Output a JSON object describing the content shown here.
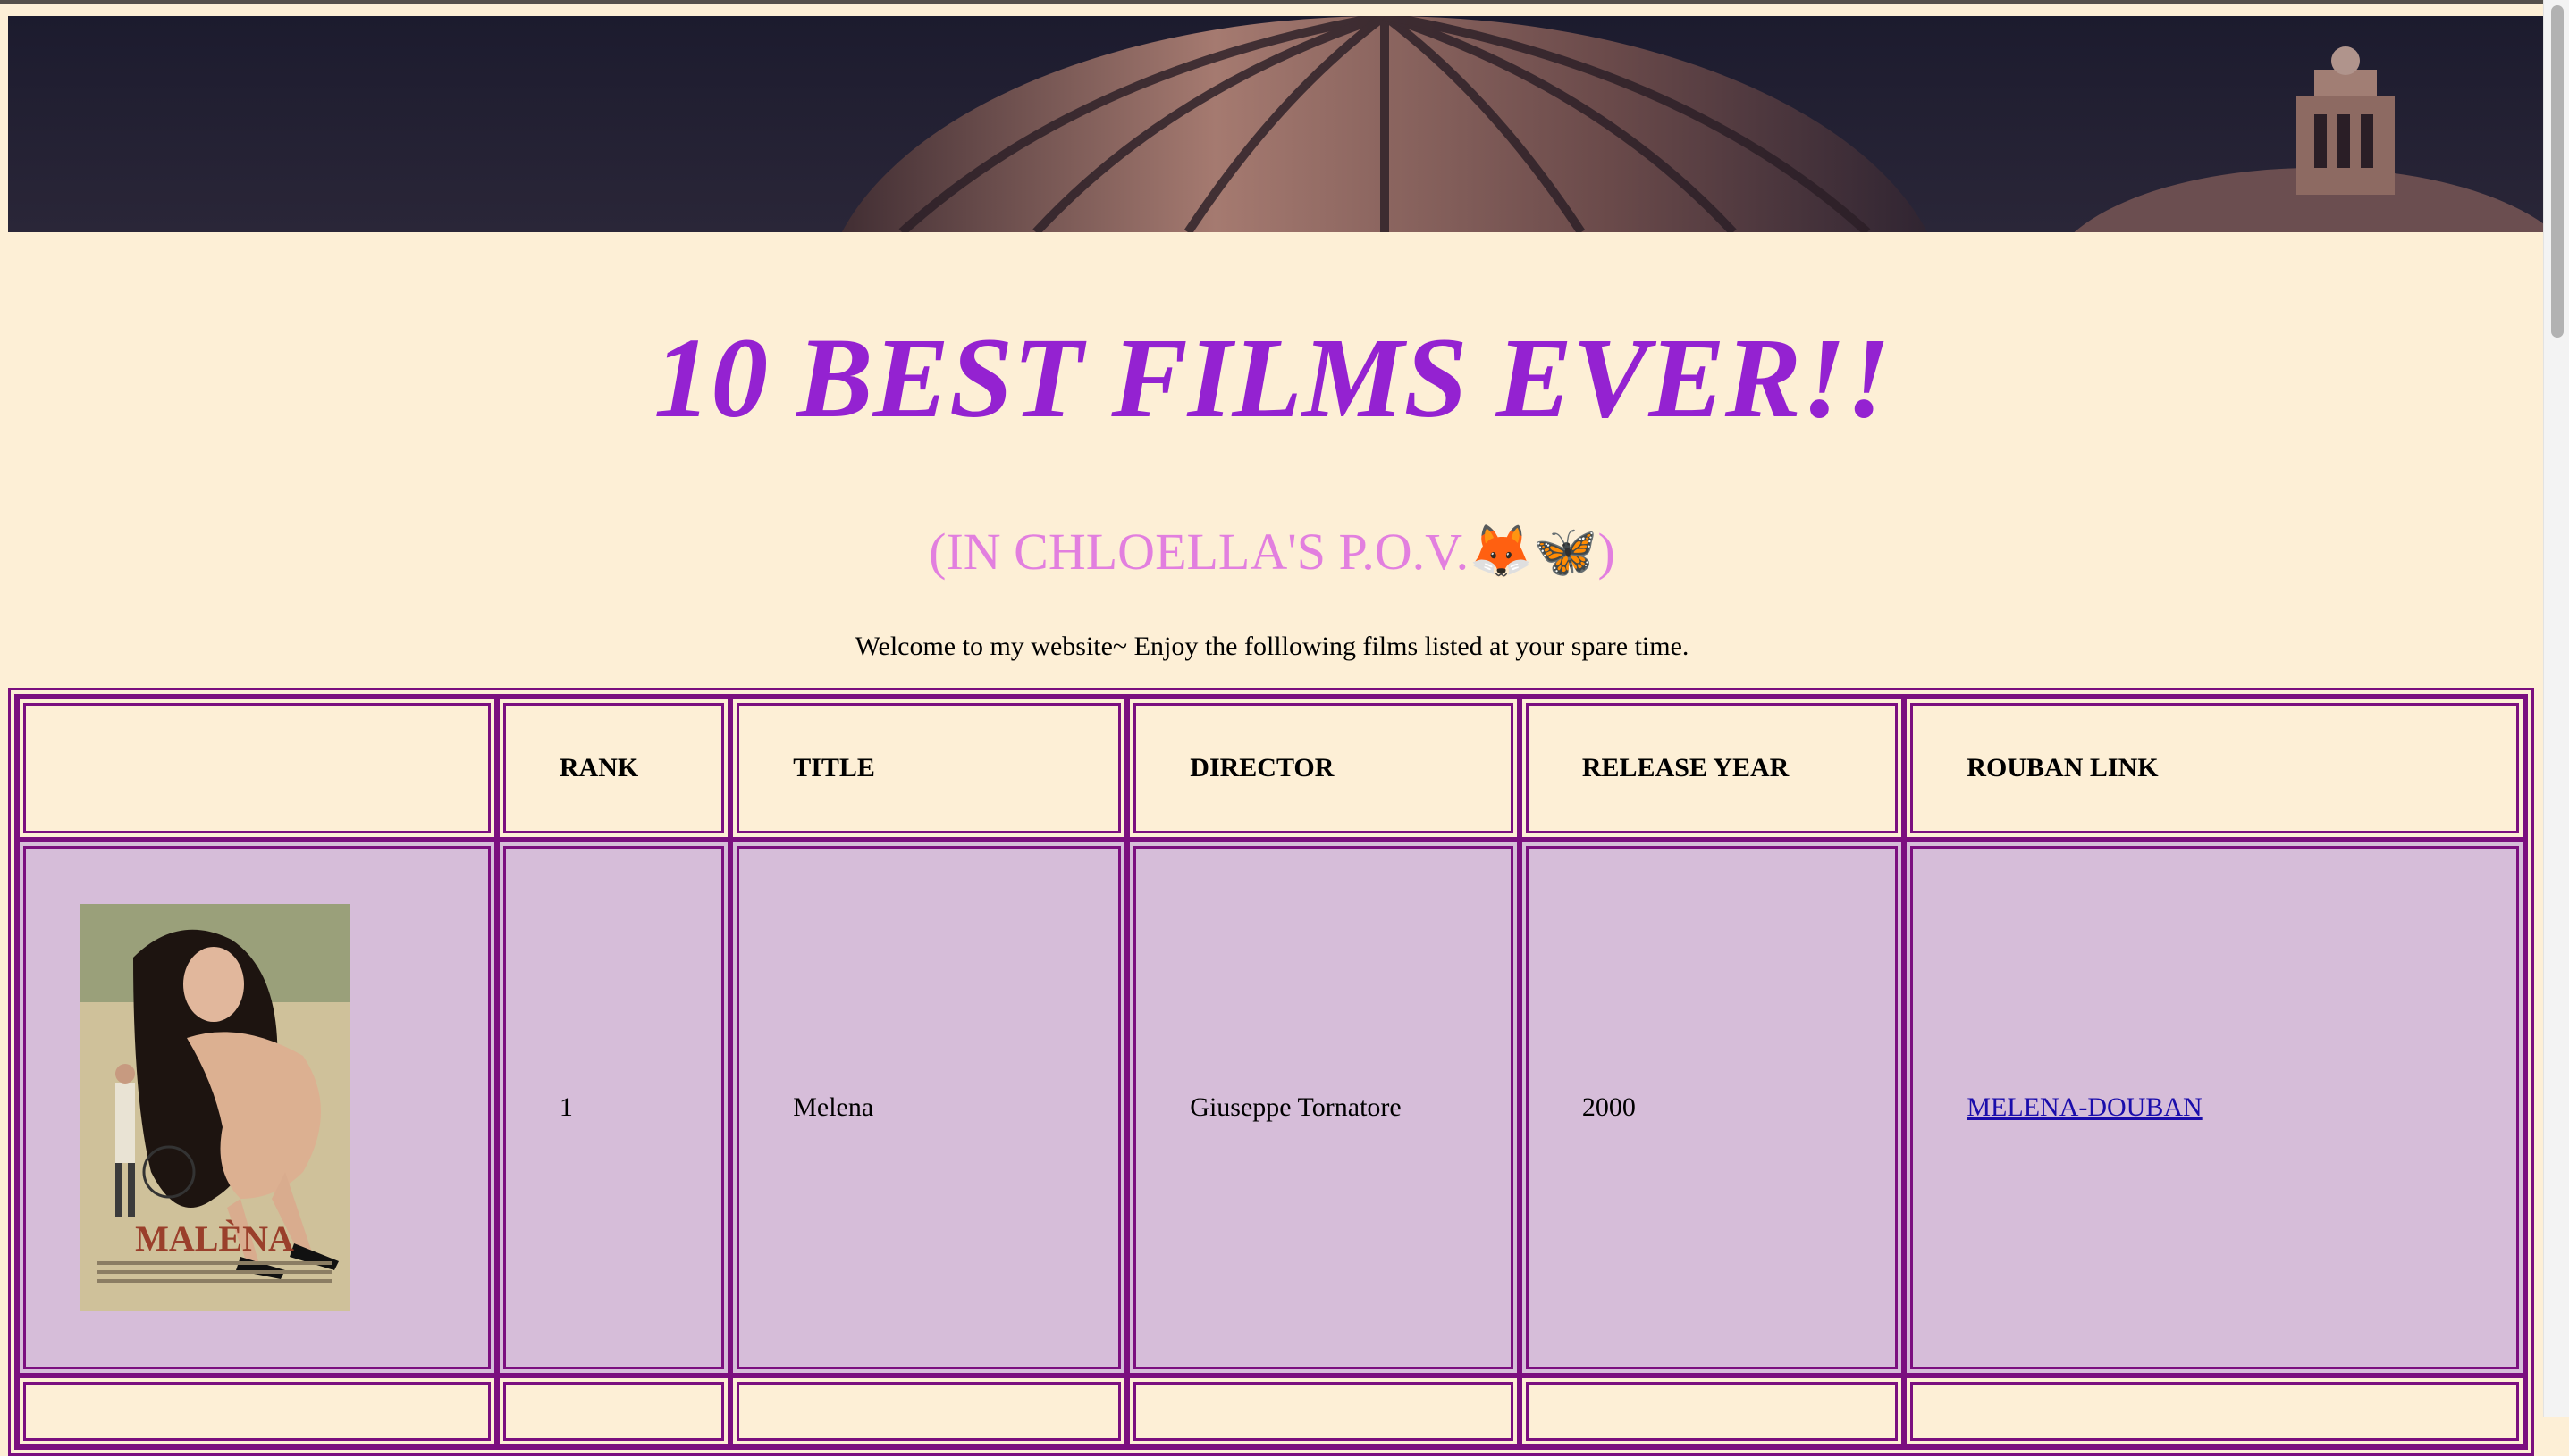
{
  "page": {
    "title": "10 BEST FILMS EVER!!",
    "subtitle": "(IN CHLOELLA'S P.O.V.🦊🦋)",
    "welcome": "Welcome to my website~ Enjoy the folllowing films listed at your spare time."
  },
  "table": {
    "headers": [
      "",
      "RANK",
      "TITLE",
      "DIRECTOR",
      "RELEASE YEAR",
      "ROUBAN LINK"
    ],
    "rows": [
      {
        "poster_caption": "MALÈNA",
        "rank": "1",
        "title": "Melena",
        "director": "Giuseppe Tornatore",
        "year": "2000",
        "link": "MELENA-DOUBAN"
      }
    ]
  },
  "colors": {
    "background": "#fdefd6",
    "title": "#9422d1",
    "subtitle": "#e27fdf",
    "table_border": "#7b0f7f",
    "row_bg": "#d6bdd9",
    "link": "#1a0dab"
  }
}
